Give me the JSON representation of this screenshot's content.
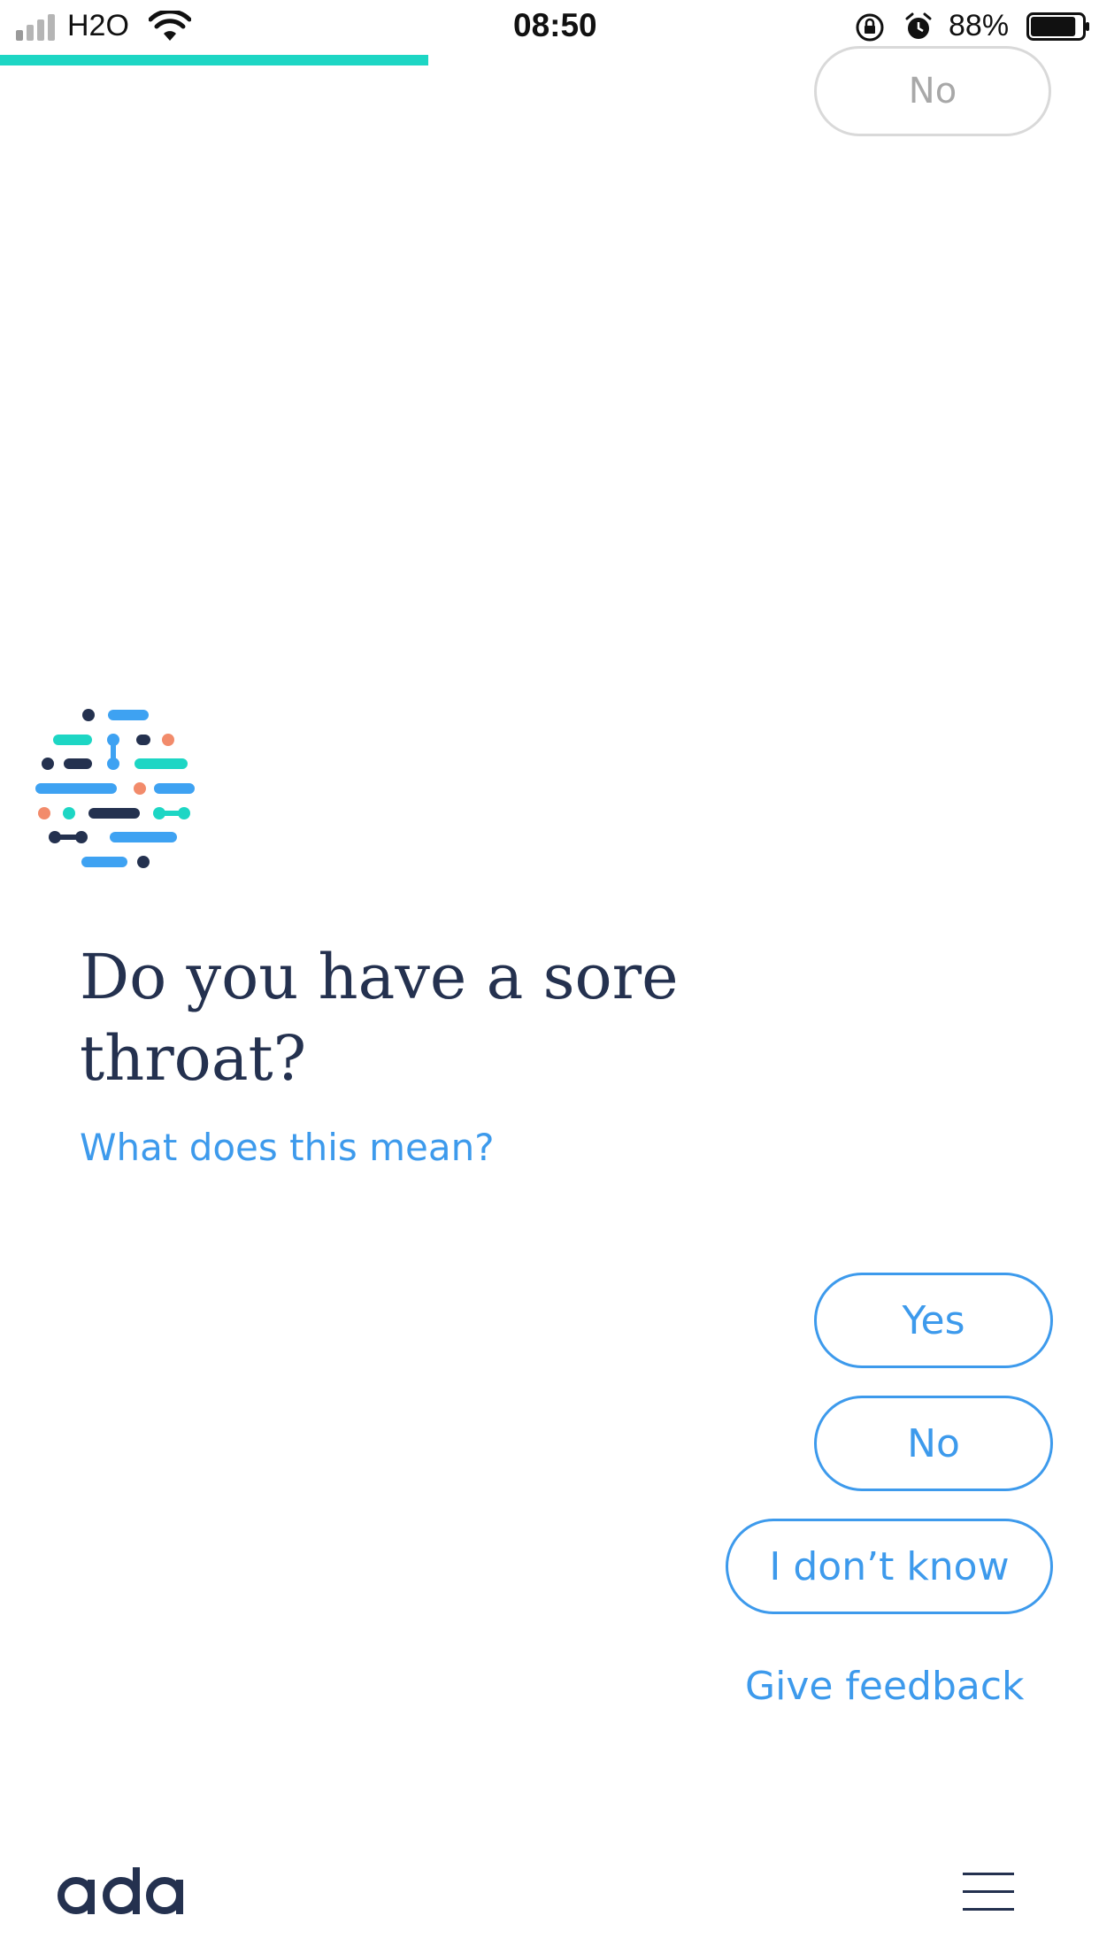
{
  "status_bar": {
    "carrier": "H2O",
    "time": "08:50",
    "battery_percent": "88%",
    "battery_level": 0.88,
    "signal_bars_total": 4,
    "signal_bars_active": 1
  },
  "progress": {
    "fraction": 0.39,
    "color": "#1dd6c4"
  },
  "previous_answer": {
    "label": "No"
  },
  "question": {
    "text": "Do you have a sore throat?",
    "help_link": "What does this mean?"
  },
  "answers": [
    {
      "label": "Yes"
    },
    {
      "label": "No"
    },
    {
      "label": "I don’t know"
    }
  ],
  "feedback": {
    "label": "Give feedback"
  },
  "footer": {
    "brand": "ada",
    "menu_icon": "hamburger-menu-icon"
  },
  "colors": {
    "accent": "#3d9aec",
    "teal": "#1dd6c4",
    "navy": "#24314f",
    "coral": "#f28b6b",
    "blue_light": "#3ea2f2"
  }
}
